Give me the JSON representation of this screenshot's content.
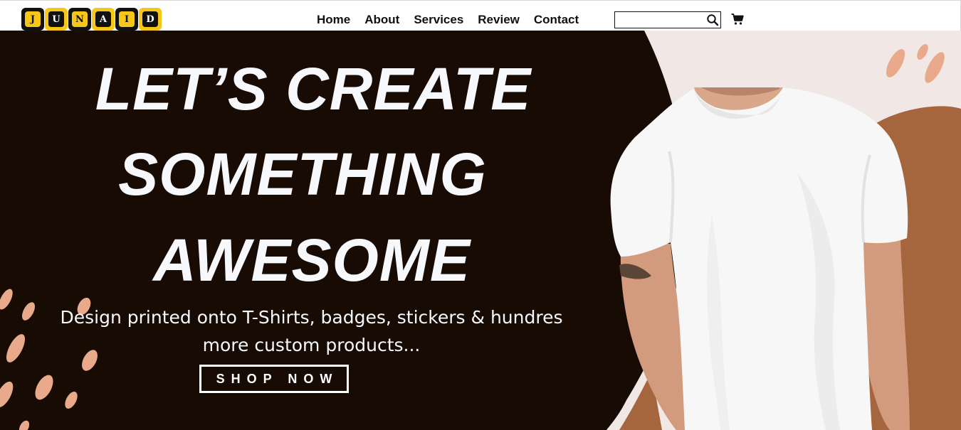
{
  "logo": {
    "letters": [
      "J",
      "U",
      "N",
      "A",
      "I",
      "D"
    ]
  },
  "nav": {
    "links": [
      {
        "label": "Home"
      },
      {
        "label": "About"
      },
      {
        "label": "Services"
      },
      {
        "label": "Review"
      },
      {
        "label": "Contact"
      }
    ],
    "search": {
      "value": "",
      "placeholder": ""
    },
    "icons": {
      "search": "search-icon",
      "cart": "cart-icon"
    }
  },
  "hero": {
    "headline": [
      "LET’S CREATE",
      "SOMETHING",
      "AWESOME"
    ],
    "subtitle_line1": "Design printed onto T-Shirts, badges, stickers & hundres",
    "subtitle_line2": "more custom products...",
    "cta_label": "SHOP NOW"
  },
  "colors": {
    "hero_dark": "#170b04",
    "accent_brown": "#a5653d",
    "accent_peach": "#e8aa8a",
    "background_light": "#f1e7e4",
    "logo_yellow": "#f6c619"
  }
}
